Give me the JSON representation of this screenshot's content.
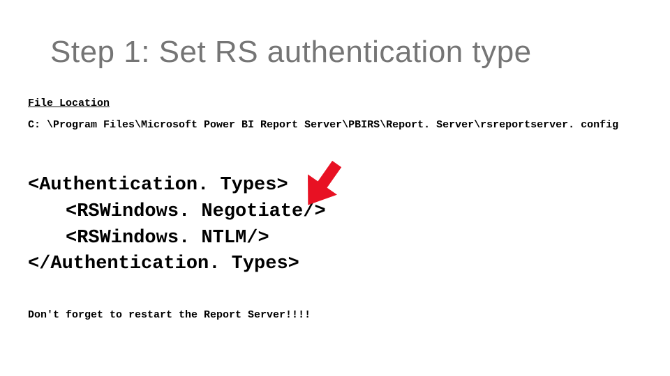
{
  "title": "Step 1:  Set RS authentication type",
  "file_location": {
    "label": "File Location",
    "path": "C: \\Program Files\\Microsoft Power BI Report Server\\PBIRS\\Report. Server\\rsreportserver. config"
  },
  "code": {
    "line1": "<Authentication. Types>",
    "line2": "<RSWindows. Negotiate/>",
    "line3": "<RSWindows. NTLM/>",
    "line4": "</Authentication. Types>"
  },
  "reminder": "Don't forget to restart the Report Server!!!!",
  "arrow_color": "#E81123"
}
